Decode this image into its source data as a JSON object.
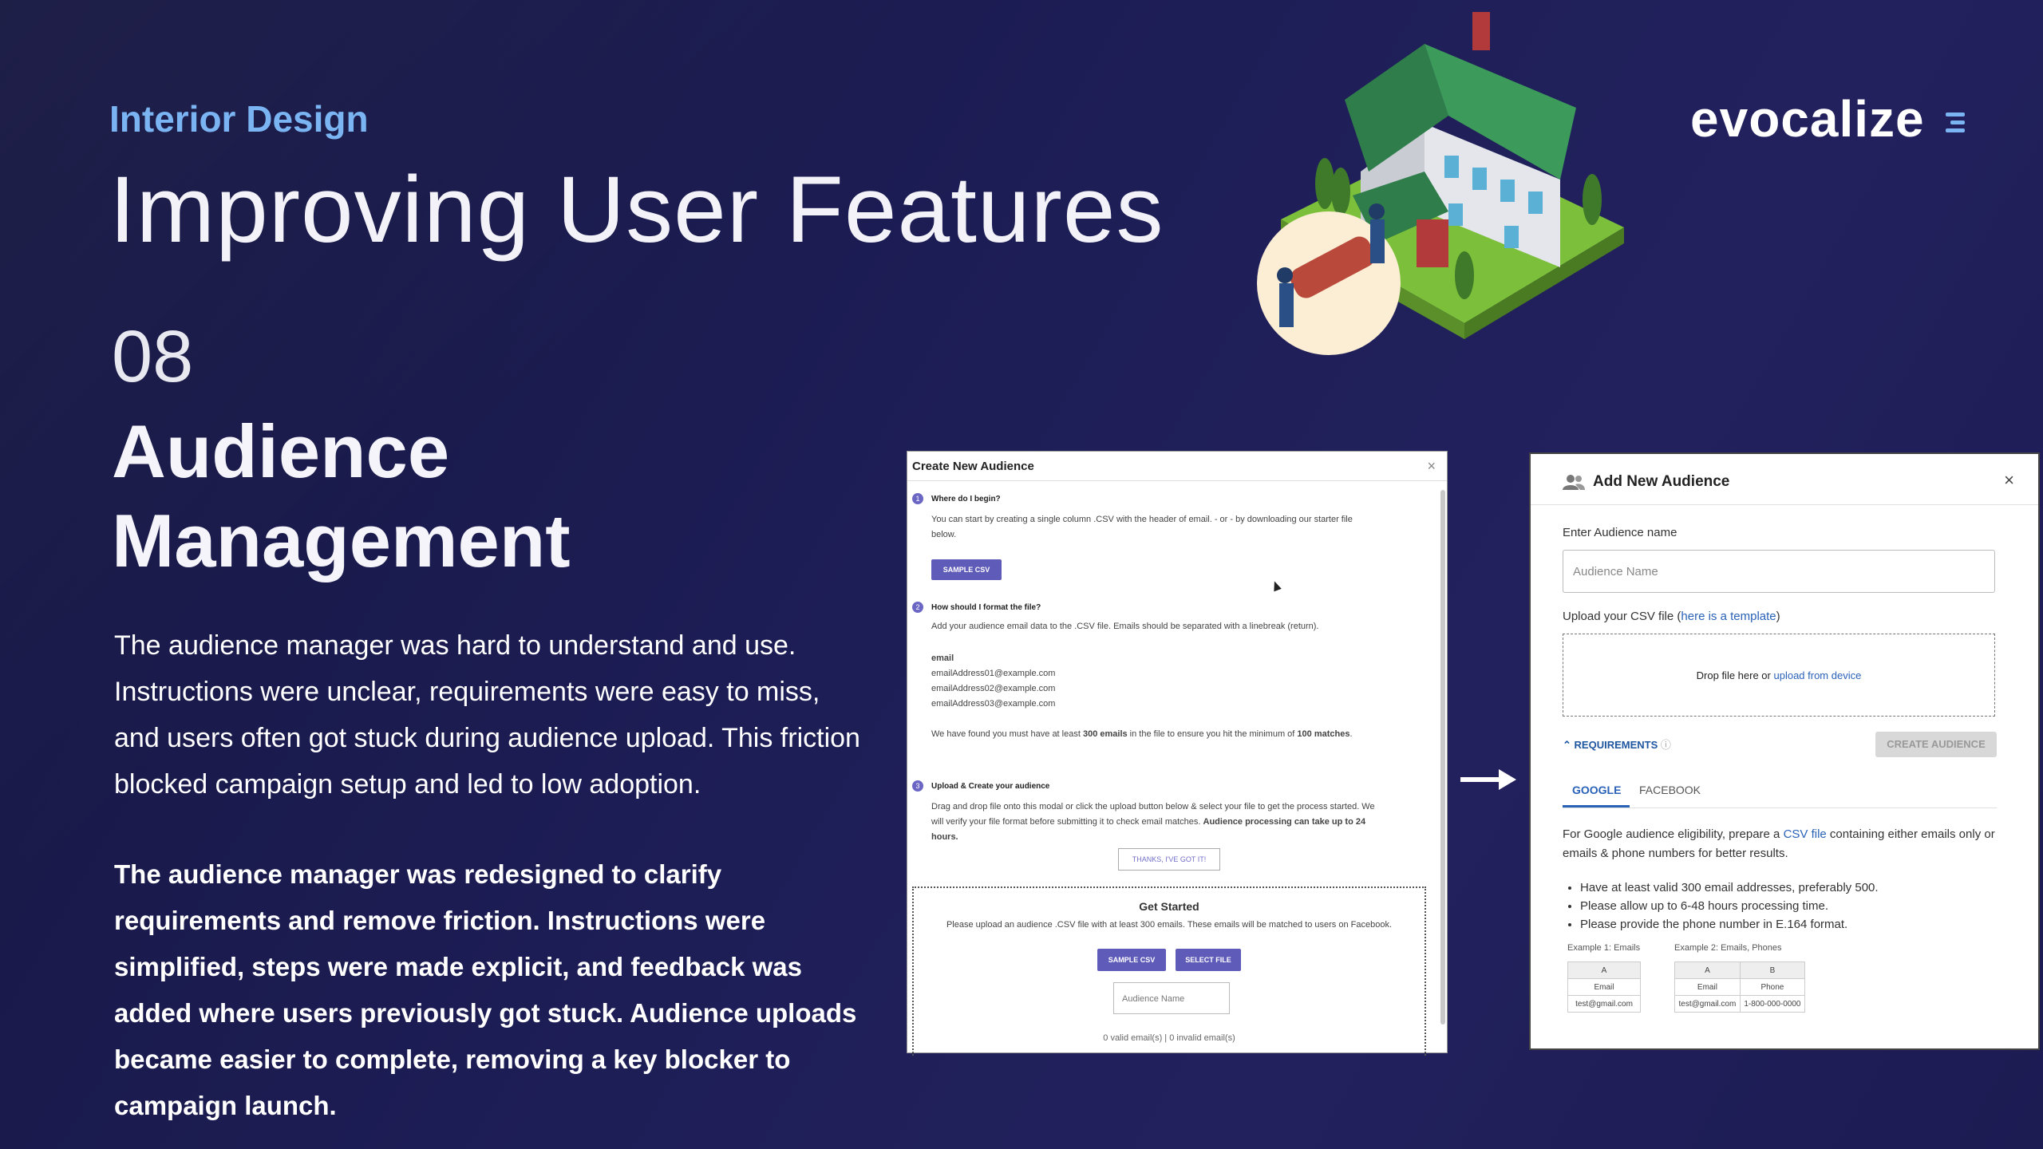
{
  "header": {
    "eyebrow": "Interior Design",
    "title": "Improving User Features",
    "brand": "evocalize"
  },
  "section": {
    "number": "08",
    "title_line1": "Audience",
    "title_line2": "Management",
    "problem": "The audience manager was hard to understand and use. Instructions were unclear, requirements were easy to miss, and users often got stuck during audience upload. This friction blocked campaign setup and led to low adoption.",
    "solution": "The audience manager was redesigned to clarify requirements and remove friction. Instructions were simplified, steps were made explicit, and feedback was added where users previously got stuck. Audience uploads became easier to complete, removing a key blocker to campaign launch."
  },
  "old_modal": {
    "title": "Create New Audience",
    "close": "×",
    "step1_num": "1",
    "step1_heading": "Where do I begin?",
    "step1_text": "You can start by creating a single column .CSV with the header of email. - or - by downloading our starter file below.",
    "sample_csv": "SAMPLE CSV",
    "step2_num": "2",
    "step2_heading": "How should I format the file?",
    "step2_text": "Add your audience email data to the .CSV file. Emails should be separated with a linebreak (return).",
    "email_header": "email",
    "emails": [
      "emailAddress01@example.com",
      "emailAddress02@example.com",
      "emailAddress03@example.com"
    ],
    "min_note_a": "We have found you must have at least ",
    "min_note_b": "300 emails",
    "min_note_c": " in the file to ensure you hit the minimum of ",
    "min_note_d": "100 matches",
    "min_note_e": ".",
    "step3_num": "3",
    "step3_heading": "Upload & Create your audience",
    "step3_text": "Drag and drop file onto this modal or click the upload button below & select your file to get the process started. We will verify your file format before submitting it to check email matches. ",
    "step3_bold": "Audience processing can take up to 24 hours.",
    "thanks": "THANKS, I'VE GOT IT!",
    "gs_title": "Get Started",
    "gs_sub": "Please upload an audience .CSV file with at least 300 emails. These emails will be matched to users on Facebook.",
    "gs_sample": "SAMPLE CSV",
    "gs_select": "SELECT FILE",
    "gs_placeholder": "Audience Name",
    "gs_count": "0 valid email(s)  |  0 invalid email(s)"
  },
  "new_modal": {
    "title": "Add New Audience",
    "close": "×",
    "name_label": "Enter Audience name",
    "name_placeholder": "Audience Name",
    "upload_label_a": "Upload your CSV file (",
    "upload_label_link": "here is a template",
    "upload_label_b": ")",
    "drop_text": "Drop file here or ",
    "drop_link": "upload from device",
    "requirements": "REQUIREMENTS",
    "create": "CREATE AUDIENCE",
    "tabs": [
      "GOOGLE",
      "FACEBOOK"
    ],
    "desc_a": "For Google audience eligibility, prepare a ",
    "desc_link": "CSV file",
    "desc_b": " containing either emails only or emails & phone numbers for better results.",
    "bullets": [
      "Have at least valid 300 email addresses, preferably 500.",
      "Please allow up to 6-48 hours processing time.",
      "Please provide the phone number in E.164 format."
    ],
    "ex1_label": "Example 1: Emails",
    "ex2_label": "Example 2: Emails, Phones",
    "ex1_rows": [
      [
        "A"
      ],
      [
        "Email"
      ],
      [
        "test@gmail.com"
      ]
    ],
    "ex2_rows": [
      [
        "A",
        "B"
      ],
      [
        "Email",
        "Phone"
      ],
      [
        "test@gmail.com",
        "1-800-000-0000"
      ]
    ]
  },
  "colors": {
    "accent": "#7ab4f2",
    "button": "#5f5bb8",
    "link": "#2a62b8"
  }
}
